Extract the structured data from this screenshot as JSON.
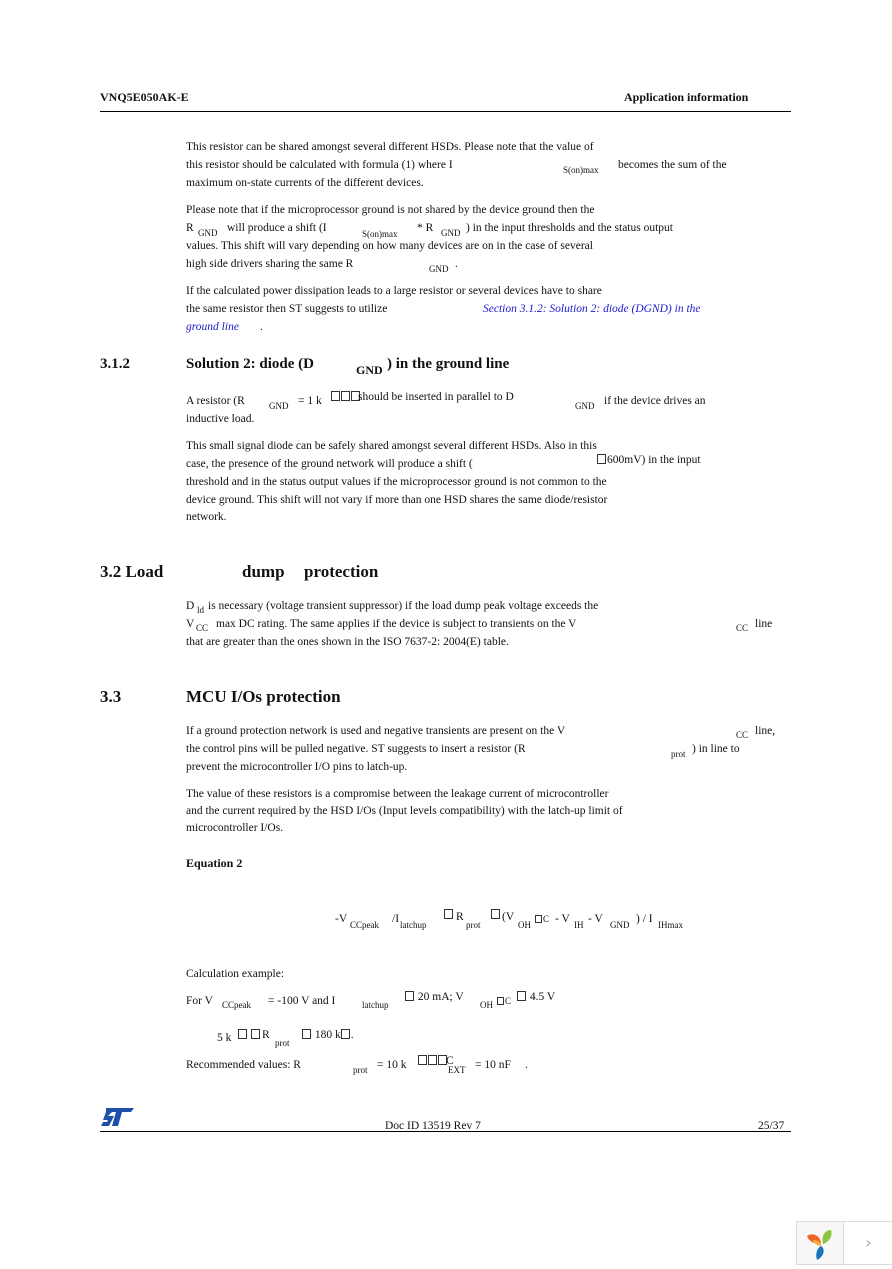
{
  "header": {
    "doc_name": "VNQ5E050AK-E",
    "section_name": "Application information"
  },
  "para1": {
    "line1": "This resistor can be shared amongst several different HSDs. Please note that the value of",
    "line2a": "this resistor should be calculated with formula (1) where I",
    "line2sub": "S(on)max",
    "line2b": "becomes the sum of the",
    "line3": "maximum on-state currents of the different devices."
  },
  "para2": {
    "line1": "Please note that if the microprocessor ground is not shared by the device ground then the",
    "line2_r": "R",
    "line2_gnd": "GND",
    "line2a": "will produce a shift (I",
    "line2sub": "S(on)max",
    "line2b": "* R",
    "line2_gnd2": "GND",
    "line2c": ") in the input thresholds and the status output",
    "line3": "values. This shift will vary depending on how many devices are on in the case of several",
    "line4a": "high side drivers sharing the same R",
    "line4sub": "GND",
    "line4b": "."
  },
  "para3": {
    "line1": "If the calculated power dissipation leads to a large resistor or several devices have to share",
    "line2a": "the same resistor then ST suggests to utilize",
    "link_part1": "Section 3.1.2: Solution 2: diode (DGND) in the",
    "link_part2": "ground line",
    "end": "."
  },
  "section_312": {
    "number": "3.1.2",
    "title_a": "Solution 2: diode (D",
    "title_sub": "GND",
    "title_b": ") in the ground line",
    "p1_a": "A resistor (R",
    "p1_sub": "GND",
    "p1_b": "= 1 k",
    "p1_c": "should be inserted in parallel to D",
    "p1_sub2": "GND",
    "p1_d": "if the device drives an",
    "p1_line2": "inductive load.",
    "p2_line1": "This small signal diode can be safely shared amongst several different HSDs. Also in this",
    "p2_line2a": "case, the presence of the ground network will produce a shift (",
    "p2_line2b": "600mV) in the input",
    "p2_line3": "threshold and in the status output values if the microprocessor ground is not common to the",
    "p2_line4": "device ground. This shift will not vary if more than one HSD shares the same diode/resistor",
    "p2_line5": "network."
  },
  "section_32": {
    "number_title": "3.2 Load",
    "title_b": "dump",
    "title_c": "protection",
    "l1_d": "D",
    "l1_sub": "ld",
    "l1_rest": "is necessary (voltage transient suppressor) if the load dump peak voltage exceeds the",
    "l2_v": "V",
    "l2_sub": "CC",
    "l2_rest": "max DC rating. The same applies if the device is subject to transients on the V",
    "l2_sub2": "CC",
    "l2_end": "line",
    "l3": "that are greater than the ones shown in the ISO 7637-2: 2004(E) table."
  },
  "section_33": {
    "number": "3.3",
    "title": "MCU I/Os protection",
    "p1_l1a": "If a ground protection network is used and negative transients are present on the V",
    "p1_l1sub": "CC",
    "p1_l1b": "line,",
    "p1_l2a": "the control pins will be pulled negative. ST suggests to insert a resistor (R",
    "p1_l2sub": "prot",
    "p1_l2b": ") in line to",
    "p1_l3": "prevent the microcontroller I/O pins to latch-up.",
    "p2_l1": "The value of these resistors is a compromise between the leakage current of microcontroller",
    "p2_l2": "and the current required by the HSD I/Os (Input levels compatibility) with the latch-up limit of",
    "p2_l3": "microcontroller I/Os."
  },
  "equation": {
    "label": "Equation 2",
    "t1": "-V",
    "s1": "CCpeak",
    "t2": "/I",
    "s2": "latchup",
    "t3": "R",
    "s3": "prot",
    "t4": "(V",
    "s4": "OH",
    "t4b": "C",
    "t5": "- V",
    "s5": "IH",
    "t6": "- V",
    "s6": "GND",
    "t7": ") / I",
    "s7": "IHmax"
  },
  "calc": {
    "label": "Calculation example:",
    "l1_a": "For V",
    "l1_s1": "CCpeak",
    "l1_b": "= -100 V and I",
    "l1_s2": "latchup",
    "l1_c": "20 mA; V",
    "l1_s3": "OH",
    "l1_c2": "C",
    "l1_d": "4.5 V",
    "l2_a": "5 k",
    "l2_b": "R",
    "l2_s": "prot",
    "l2_c": "180 k",
    "l2_d": ".",
    "l3_a": "Recommended values: R",
    "l3_s": "prot",
    "l3_b": "= 10 k",
    "l3_c": "C",
    "l3_s2": "EXT",
    "l3_d": "= 10 nF",
    "l3_e": "."
  },
  "footer": {
    "doc_id": "Doc ID 13519 Rev 7",
    "page": "25/37"
  },
  "viewer": {
    "next_label": "›"
  }
}
